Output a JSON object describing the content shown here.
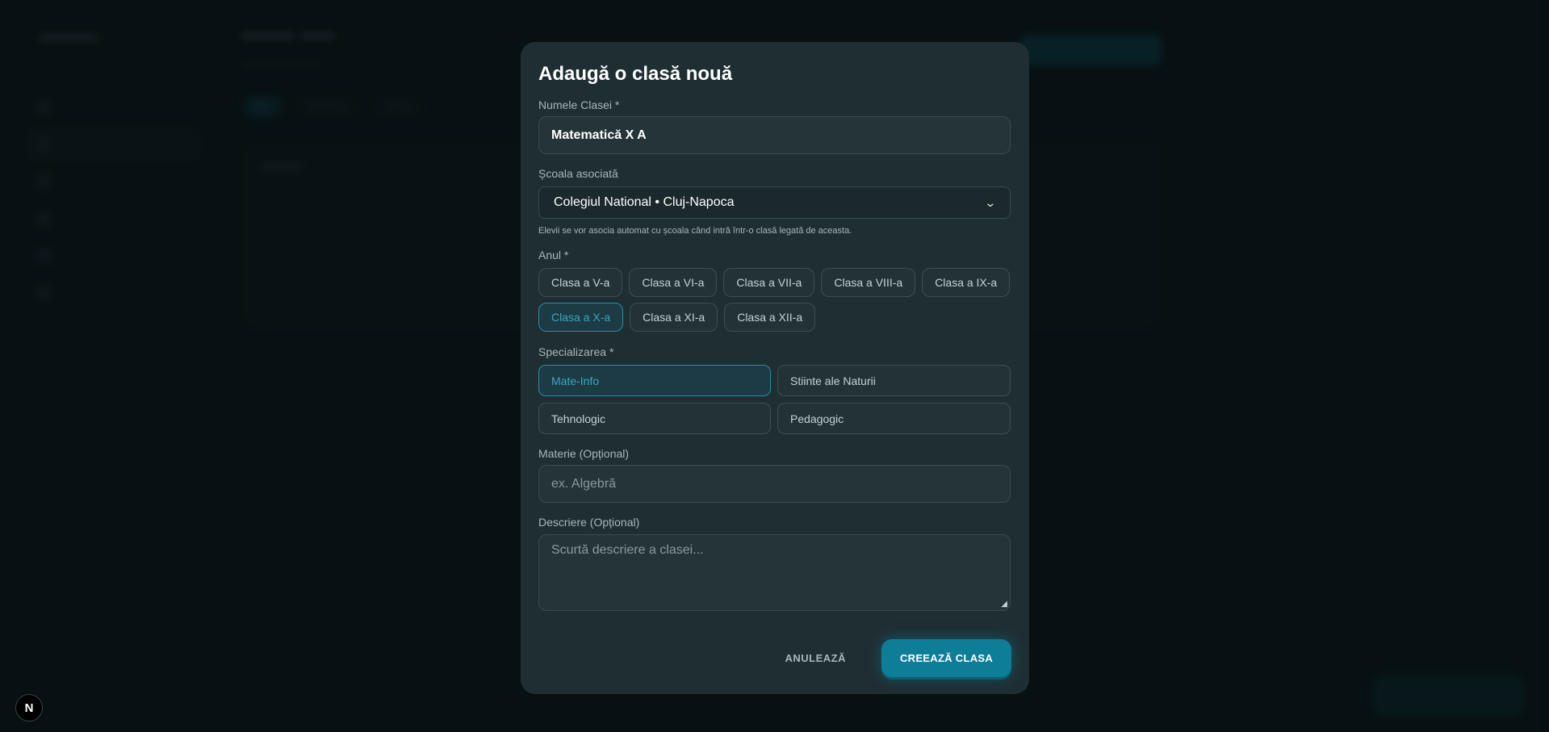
{
  "modal": {
    "title": "Adaugă o clasă nouă",
    "class_name": {
      "label": "Numele Clasei *",
      "value": "Matematică X A"
    },
    "school": {
      "label": "Școala asociată",
      "selected": "Colegiul National • Cluj-Napoca",
      "hint": "Elevii se vor asocia automat cu școala când intră într-o clasă legată de aceasta."
    },
    "year": {
      "label": "Anul *",
      "options": [
        "Clasa a V-a",
        "Clasa a VI-a",
        "Clasa a VII-a",
        "Clasa a VIII-a",
        "Clasa a IX-a",
        "Clasa a X-a",
        "Clasa a XI-a",
        "Clasa a XII-a"
      ],
      "selected": "Clasa a X-a"
    },
    "specialization": {
      "label": "Specializarea *",
      "options": [
        "Mate-Info",
        "Stiinte ale Naturii",
        "Tehnologic",
        "Pedagogic"
      ],
      "selected": "Mate-Info"
    },
    "subject": {
      "label": "Materie (Opțional)",
      "placeholder": "ex. Algebră"
    },
    "description": {
      "label": "Descriere (Opțional)",
      "placeholder": "Scurtă descriere a clasei..."
    },
    "cancel_label": "ANULEAZĂ",
    "create_label": "CREEAZĂ CLASA"
  },
  "colors": {
    "accent": "#0e7d98",
    "selected_text": "#3ba6c0",
    "modal_bg": "#1f2e33"
  },
  "next_badge": "N"
}
